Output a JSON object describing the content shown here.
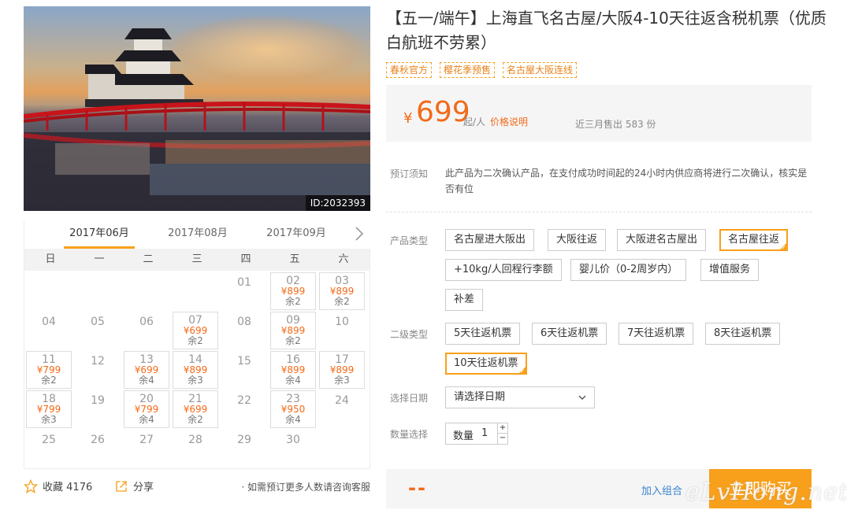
{
  "hero": {
    "id_tag": "ID:2032393"
  },
  "calendar": {
    "tabs": [
      "2017年06月",
      "2017年08月",
      "2017年09月"
    ],
    "active_tab": 0,
    "weekdays": [
      "日",
      "一",
      "二",
      "三",
      "四",
      "五",
      "六"
    ],
    "days": [
      {
        "d": "01",
        "col": 4,
        "row": 0
      },
      {
        "d": "02",
        "col": 5,
        "row": 0,
        "price": "¥899",
        "rem": "余2"
      },
      {
        "d": "03",
        "col": 6,
        "row": 0,
        "price": "¥899",
        "rem": "余2"
      },
      {
        "d": "04",
        "col": 0,
        "row": 1
      },
      {
        "d": "05",
        "col": 1,
        "row": 1
      },
      {
        "d": "06",
        "col": 2,
        "row": 1
      },
      {
        "d": "07",
        "col": 3,
        "row": 1,
        "price": "¥699",
        "rem": "余2"
      },
      {
        "d": "08",
        "col": 4,
        "row": 1
      },
      {
        "d": "09",
        "col": 5,
        "row": 1,
        "price": "¥899",
        "rem": "余2"
      },
      {
        "d": "10",
        "col": 6,
        "row": 1
      },
      {
        "d": "11",
        "col": 0,
        "row": 2,
        "price": "¥799",
        "rem": "余2"
      },
      {
        "d": "12",
        "col": 1,
        "row": 2
      },
      {
        "d": "13",
        "col": 2,
        "row": 2,
        "price": "¥699",
        "rem": "余4"
      },
      {
        "d": "14",
        "col": 3,
        "row": 2,
        "price": "¥899",
        "rem": "余3"
      },
      {
        "d": "15",
        "col": 4,
        "row": 2
      },
      {
        "d": "16",
        "col": 5,
        "row": 2,
        "price": "¥899",
        "rem": "余4"
      },
      {
        "d": "17",
        "col": 6,
        "row": 2,
        "price": "¥899",
        "rem": "余3"
      },
      {
        "d": "18",
        "col": 0,
        "row": 3,
        "price": "¥799",
        "rem": "余3"
      },
      {
        "d": "19",
        "col": 1,
        "row": 3
      },
      {
        "d": "20",
        "col": 2,
        "row": 3,
        "price": "¥799",
        "rem": "余4"
      },
      {
        "d": "21",
        "col": 3,
        "row": 3,
        "price": "¥699",
        "rem": "余2"
      },
      {
        "d": "22",
        "col": 4,
        "row": 3
      },
      {
        "d": "23",
        "col": 5,
        "row": 3,
        "price": "¥950",
        "rem": "余4"
      },
      {
        "d": "24",
        "col": 6,
        "row": 3
      },
      {
        "d": "25",
        "col": 0,
        "row": 4
      },
      {
        "d": "26",
        "col": 1,
        "row": 4
      },
      {
        "d": "27",
        "col": 2,
        "row": 4
      },
      {
        "d": "28",
        "col": 3,
        "row": 4
      },
      {
        "d": "29",
        "col": 4,
        "row": 4
      },
      {
        "d": "30",
        "col": 5,
        "row": 4
      }
    ]
  },
  "footer": {
    "fav_label": "收藏",
    "fav_count": "4176",
    "share_label": "分享",
    "consult": "· 如需预订更多人数请咨询客服"
  },
  "product": {
    "title": "【五一/端午】上海直飞名古屋/大阪4-10天往返含税机票（优质白航班不劳累）",
    "tags": [
      "春秋官方",
      "樱花季预售",
      "名古屋大阪连线"
    ],
    "price": {
      "currency": "¥",
      "amount": "699",
      "unit": "起/人",
      "explain": "价格说明",
      "sold": "近三月售出 583 份"
    },
    "notice_label": "预订须知",
    "notice_text": "此产品为二次确认产品，在支付成功时间起的24小时内供应商将进行二次确认，核实是否有位",
    "type_label": "产品类型",
    "types": [
      "名古屋进大阪出",
      "大阪往返",
      "大阪进名古屋出",
      "名古屋往返",
      "+10kg/人回程行李额",
      "婴儿价（0-2周岁内）",
      "增值服务",
      "补差"
    ],
    "selected_type": "名古屋往返",
    "subtype_label": "二级类型",
    "subtypes": [
      "5天往返机票",
      "6天往返机票",
      "7天往返机票",
      "8天往返机票",
      "10天往返机票"
    ],
    "selected_subtype": "10天往返机票",
    "date_label": "选择日期",
    "date_placeholder": "请选择日期",
    "qty_label_row": "数量选择",
    "qty_label": "数量",
    "qty_value": "1",
    "qty_plus": "+",
    "qty_minus": "−",
    "total": "--",
    "combo": "加入组合",
    "buy": "立即购买"
  },
  "watermark": "eLvHong.net",
  "colors": {
    "accent": "#f8a01b",
    "price": "#f26a18",
    "link": "#3a84d0"
  }
}
